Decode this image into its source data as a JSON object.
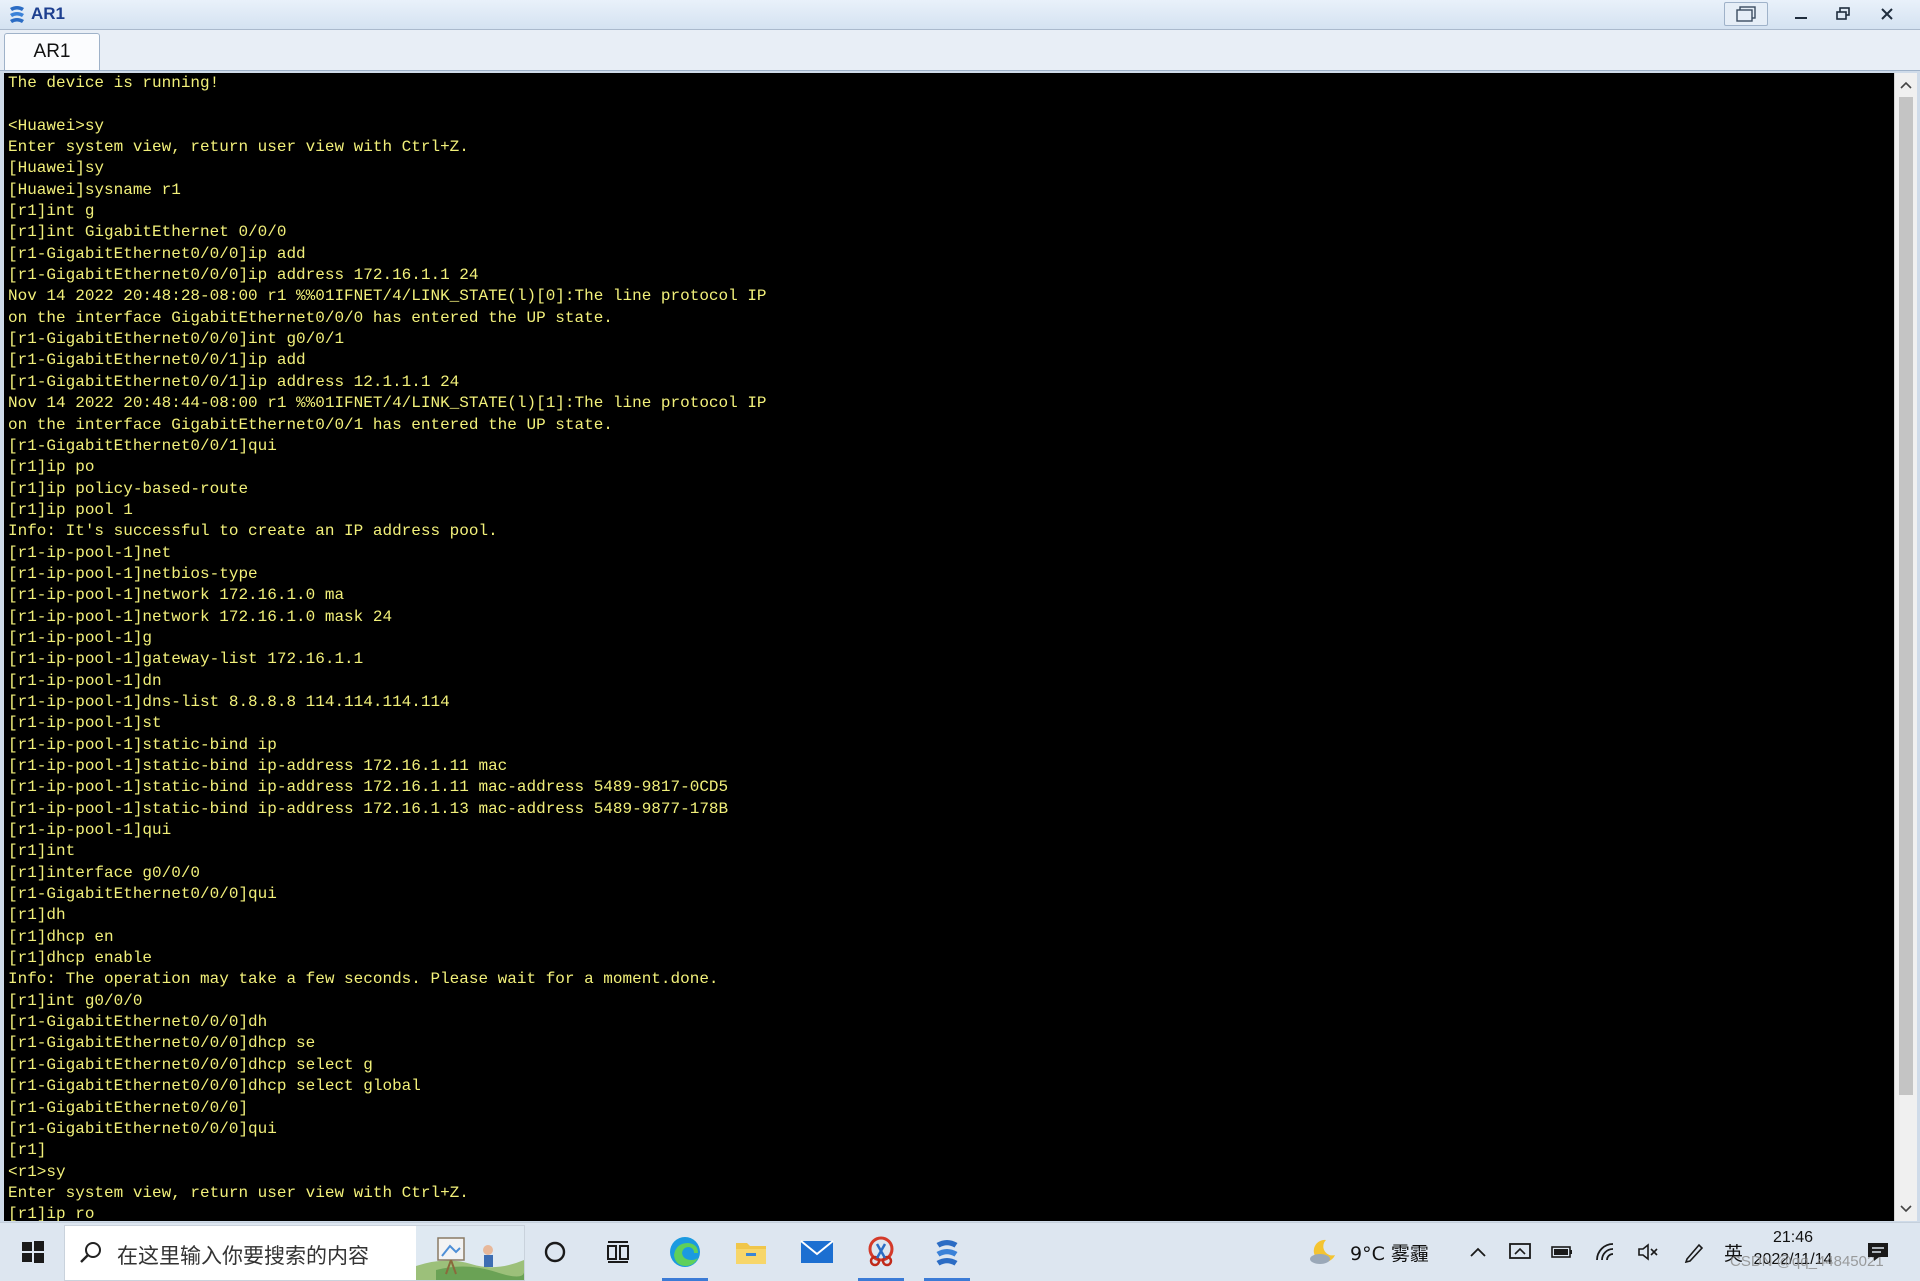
{
  "window": {
    "title": "AR1"
  },
  "tabs": [
    {
      "label": "AR1",
      "active": true
    }
  ],
  "terminal": {
    "text_color": "#f2f07a",
    "background": "#000000",
    "lines": [
      "The device is running!",
      "",
      "<Huawei>sy",
      "Enter system view, return user view with Ctrl+Z.",
      "[Huawei]sy",
      "[Huawei]sysname r1",
      "[r1]int g",
      "[r1]int GigabitEthernet 0/0/0",
      "[r1-GigabitEthernet0/0/0]ip add",
      "[r1-GigabitEthernet0/0/0]ip address 172.16.1.1 24",
      "Nov 14 2022 20:48:28-08:00 r1 %%01IFNET/4/LINK_STATE(l)[0]:The line protocol IP",
      "on the interface GigabitEthernet0/0/0 has entered the UP state.",
      "[r1-GigabitEthernet0/0/0]int g0/0/1",
      "[r1-GigabitEthernet0/0/1]ip add",
      "[r1-GigabitEthernet0/0/1]ip address 12.1.1.1 24",
      "Nov 14 2022 20:48:44-08:00 r1 %%01IFNET/4/LINK_STATE(l)[1]:The line protocol IP",
      "on the interface GigabitEthernet0/0/1 has entered the UP state.",
      "[r1-GigabitEthernet0/0/1]qui",
      "[r1]ip po",
      "[r1]ip policy-based-route",
      "[r1]ip pool 1",
      "Info: It's successful to create an IP address pool.",
      "[r1-ip-pool-1]net",
      "[r1-ip-pool-1]netbios-type",
      "[r1-ip-pool-1]network 172.16.1.0 ma",
      "[r1-ip-pool-1]network 172.16.1.0 mask 24",
      "[r1-ip-pool-1]g",
      "[r1-ip-pool-1]gateway-list 172.16.1.1",
      "[r1-ip-pool-1]dn",
      "[r1-ip-pool-1]dns-list 8.8.8.8 114.114.114.114",
      "[r1-ip-pool-1]st",
      "[r1-ip-pool-1]static-bind ip",
      "[r1-ip-pool-1]static-bind ip-address 172.16.1.11 mac",
      "[r1-ip-pool-1]static-bind ip-address 172.16.1.11 mac-address 5489-9817-0CD5",
      "[r1-ip-pool-1]static-bind ip-address 172.16.1.13 mac-address 5489-9877-178B",
      "[r1-ip-pool-1]qui",
      "[r1]int",
      "[r1]interface g0/0/0",
      "[r1-GigabitEthernet0/0/0]qui",
      "[r1]dh",
      "[r1]dhcp en",
      "[r1]dhcp enable",
      "Info: The operation may take a few seconds. Please wait for a moment.done.",
      "[r1]int g0/0/0",
      "[r1-GigabitEthernet0/0/0]dh",
      "[r1-GigabitEthernet0/0/0]dhcp se",
      "[r1-GigabitEthernet0/0/0]dhcp select g",
      "[r1-GigabitEthernet0/0/0]dhcp select global",
      "[r1-GigabitEthernet0/0/0]",
      "[r1-GigabitEthernet0/0/0]qui",
      "[r1]",
      "<r1>sy",
      "Enter system view, return user view with Ctrl+Z.",
      "[r1]ip ro"
    ]
  },
  "taskbar": {
    "search_placeholder": "在这里输入你要搜索的内容",
    "icons": [
      "windows-start-icon",
      "search-icon",
      "cortana-circle-icon",
      "task-view-icon",
      "edge-icon",
      "file-explorer-icon",
      "mail-icon",
      "snipping-tool-icon",
      "ensp-app-icon"
    ],
    "weather": "9°C 雾霾",
    "ime": "英",
    "time": "21:46",
    "date": "2022/11/14",
    "watermark": "CSDN @qq_44845021"
  }
}
